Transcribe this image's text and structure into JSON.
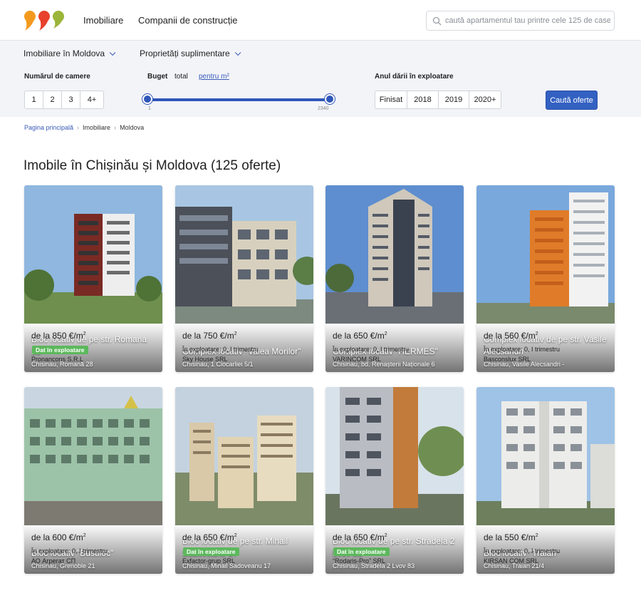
{
  "header": {
    "nav": [
      "Imobiliare",
      "Companii de construcție"
    ],
    "search_placeholder": "caută apartamentul tau printre cele 125 de case"
  },
  "filters": {
    "dropdown_location": "Imobiliare în Moldova",
    "dropdown_extra": "Proprietăți suplimentare",
    "rooms_label": "Numărul de camere",
    "rooms": [
      "1",
      "2",
      "3",
      "4+"
    ],
    "budget_label": "Buget",
    "budget_total": "total",
    "budget_per_m": "pentru m²",
    "slider_min": "1",
    "slider_max": "2340",
    "year_label": "Anul dării în exploatare",
    "years": [
      "Finisat",
      "2018",
      "2019",
      "2020+"
    ],
    "search_button": "Caută oferte"
  },
  "breadcrumb": [
    "Pagina principală",
    "Imobiliare",
    "Moldova"
  ],
  "page_title": "Imobile în Chișinău și Moldova (125 oferte)",
  "listings": [
    {
      "title": "Bloc locativ de pe str. Romana 28",
      "address": "Chisinau, Romană 28",
      "price": "de la 850 €/m",
      "status": "Dat în exploatare",
      "badge": true,
      "developer": "Pronancons S.R.L"
    },
    {
      "title": "Complex locativ \"Valea Morilor\"",
      "address": "Chisinau, 1 Ciocarliei 5/1",
      "price": "de la 750 €/m",
      "status": "În exploatare: 0, I trimestru",
      "badge": false,
      "developer": "Sky House SRL"
    },
    {
      "title": "Complex locativ \"HERMES\"",
      "address": "Chisinau, bd. Renașterii Naționale 6",
      "price": "de la 650 €/m",
      "status": "În exploatare: 0, I trimestru",
      "badge": false,
      "developer": "VARINCOM SRL"
    },
    {
      "title": "Complex locativ de pe str. Vasile Alecsandri",
      "address": "Chisinau, Vasile Alecsandri -",
      "price": "de la 560 €/m",
      "status": "În exploatare: 0, I trimestru",
      "badge": false,
      "developer": "Basconslux SRL"
    },
    {
      "title": "Bloc locativ \"Busuioc\"",
      "address": "Chisinau, Grenoble 21",
      "price": "de la 600 €/m",
      "status": "În exploatare: 0, I trimestru",
      "badge": false,
      "developer": "АО Агрегат СП"
    },
    {
      "title": "Bloc locativ de pe str. Mihail Sadoveanu 17",
      "address": "Chisinau, Mihail Sadoveanu 17",
      "price": "de la 650 €/m",
      "status": "Dat în exploatare",
      "badge": true,
      "developer": "Exfactor-grup SRL"
    },
    {
      "title": "Bloc locativ de pe str. Stradela 2 Lvov 83",
      "address": "Chisinau, Stradela 2 Lvov 83",
      "price": "de la 650 €/m",
      "status": "Dat în exploatare",
      "badge": true,
      "developer": "“Rodaris-Pro” SRL"
    },
    {
      "title": "Bloc locativ \"Traian\"",
      "address": "Chisinau, Traian 21/4",
      "price": "de la 550 €/m",
      "status": "În exploatare: 0, I trimestru",
      "badge": false,
      "developer": "KIRSAN COM SRL"
    }
  ],
  "colors": {
    "accent": "#3361c2",
    "badge": "#5cb85c",
    "logo_orange": "#f39a1e",
    "logo_red": "#e8412c",
    "logo_green": "#9bb53a"
  }
}
